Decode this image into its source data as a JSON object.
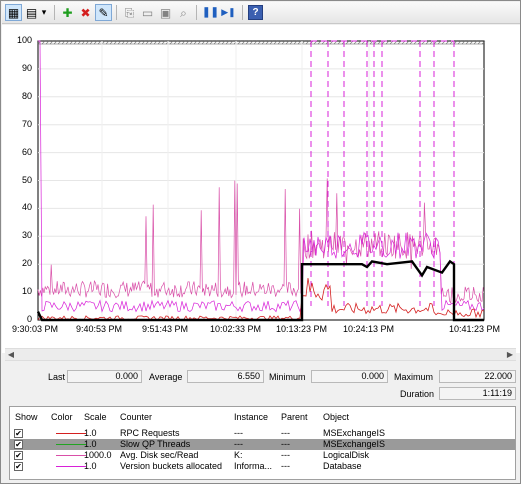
{
  "toolbar": {
    "buttons": [
      {
        "icon": "view-current-activity-icon",
        "glyph": "▦"
      },
      {
        "icon": "change-graph-type-icon",
        "glyph": "▤"
      },
      {
        "icon": "dropdown-icon",
        "glyph": "▾"
      },
      {
        "icon": "add-icon",
        "glyph": "✚",
        "color": "#1f9e1f"
      },
      {
        "icon": "delete-icon",
        "glyph": "✖",
        "color": "#d42020"
      },
      {
        "icon": "highlight-icon",
        "glyph": "✎"
      },
      {
        "icon": "copy-properties-icon",
        "glyph": "⎘"
      },
      {
        "icon": "paste-counter-list-icon",
        "glyph": "📋"
      },
      {
        "icon": "properties-icon",
        "glyph": "▣"
      },
      {
        "icon": "zoom-icon",
        "glyph": "⌕"
      },
      {
        "icon": "freeze-display-icon",
        "glyph": "❚❚",
        "color": "#1f5fbf"
      },
      {
        "icon": "update-data-icon",
        "glyph": "▶❚",
        "color": "#1f5fbf"
      },
      {
        "icon": "help-icon",
        "glyph": "?",
        "color": "#ffffff"
      }
    ]
  },
  "graph": {
    "y_ticks": [
      "100",
      "90",
      "80",
      "70",
      "60",
      "50",
      "40",
      "30",
      "20",
      "10",
      "0"
    ],
    "x_ticks": [
      "9:30:03 PM",
      "9:40:53 PM",
      "9:51:43 PM",
      "10:02:33 PM",
      "10:13:23 PM",
      "10:24:13 PM",
      "10:41:23 PM"
    ]
  },
  "stats": {
    "last_label": "Last",
    "last_value": "0.000",
    "average_label": "Average",
    "average_value": "6.550",
    "minimum_label": "Minimum",
    "minimum_value": "0.000",
    "maximum_label": "Maximum",
    "maximum_value": "22.000",
    "duration_label": "Duration",
    "duration_value": "1:11:19"
  },
  "legend": {
    "headers": {
      "show": "Show",
      "color": "Color",
      "scale": "Scale",
      "counter": "Counter",
      "instance": "Instance",
      "parent": "Parent",
      "object": "Object"
    },
    "rows": [
      {
        "checked": "✔",
        "color": "#d42020",
        "scale": "1.0",
        "counter": "RPC Requests",
        "instance": "---",
        "parent": "---",
        "object": "MSExchangeIS"
      },
      {
        "checked": "✔",
        "color": "#22a322",
        "scale": "1.0",
        "counter": "Slow QP Threads",
        "instance": "---",
        "parent": "---",
        "object": "MSExchangeIS"
      },
      {
        "checked": "✔",
        "color": "#d94fa8",
        "scale": "1000.0",
        "counter": "Avg. Disk sec/Read",
        "instance": "K:",
        "parent": "---",
        "object": "LogicalDisk"
      },
      {
        "checked": "✔",
        "color": "#d820d8",
        "scale": "1.0",
        "counter": "Version buckets allocated",
        "instance": "Informa...",
        "parent": "---",
        "object": "Database"
      }
    ]
  }
}
